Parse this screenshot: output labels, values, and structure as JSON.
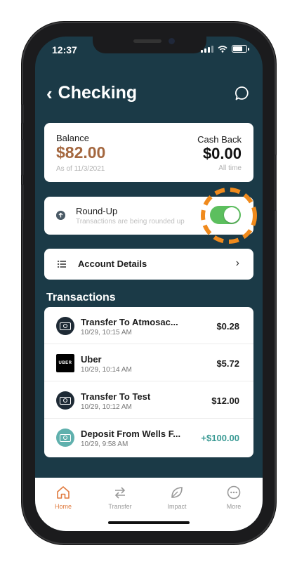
{
  "status": {
    "time": "12:37"
  },
  "header": {
    "title": "Checking"
  },
  "balance": {
    "label": "Balance",
    "value": "$82.00",
    "as_of": "As of 11/3/2021",
    "cashback_label": "Cash Back",
    "cashback_value": "$0.00",
    "cashback_sub": "All time"
  },
  "roundup": {
    "title": "Round-Up",
    "subtitle": "Transactions are being rounded up",
    "enabled": true
  },
  "account_details": {
    "label": "Account Details"
  },
  "transactions": {
    "heading": "Transactions",
    "items": [
      {
        "name": "Transfer To Atmosac...",
        "date": "10/29, 10:15 AM",
        "amount": "$0.28",
        "icon": "money-icon"
      },
      {
        "name": "Uber",
        "date": "10/29, 10:14 AM",
        "amount": "$5.72",
        "icon": "uber-logo",
        "logo_text": "UBER"
      },
      {
        "name": "Transfer To Test",
        "date": "10/29, 10:12 AM",
        "amount": "$12.00",
        "icon": "money-icon"
      },
      {
        "name": "Deposit From Wells F...",
        "date": "10/29, 9:58 AM",
        "amount": "+$100.00",
        "icon": "money-icon"
      }
    ]
  },
  "tabbar": {
    "tabs": [
      {
        "label": "Home",
        "icon": "home-icon",
        "active": true
      },
      {
        "label": "Transfer",
        "icon": "transfer-icon",
        "active": false
      },
      {
        "label": "Impact",
        "icon": "leaf-icon",
        "active": false
      },
      {
        "label": "More",
        "icon": "more-icon",
        "active": false
      }
    ]
  },
  "colors": {
    "background": "#1b3a47",
    "balance_value": "#a4673f",
    "toggle_on": "#5cbf5e",
    "highlight_ring": "#f08a1c",
    "positive_amount": "#3a9a94",
    "active_tab": "#e07a3e"
  }
}
